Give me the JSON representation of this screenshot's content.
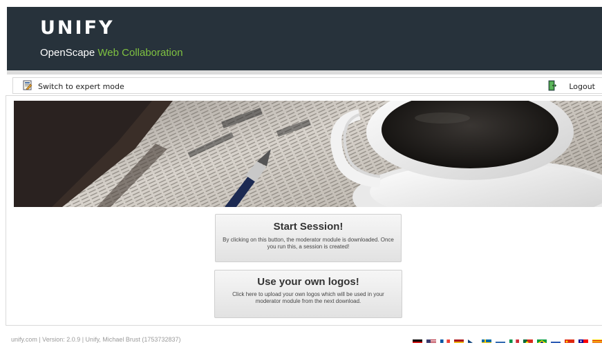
{
  "header": {
    "logo_text": "UNIFY",
    "product_name_part1": "OpenScape",
    "product_name_part2": "Web Collaboration",
    "background": "#27323b",
    "accent": "#7fc241"
  },
  "toolbar": {
    "expert_mode_label": "Switch to expert mode",
    "logout_label": "Logout"
  },
  "main": {
    "start_session": {
      "title": "Start Session!",
      "description": "By clicking on this button, the moderator module is downloaded. Once you run this, a session is created!"
    },
    "own_logos": {
      "title": "Use your own logos!",
      "description": "Click here to upload your own logos which will be used in your moderator module from the next download."
    }
  },
  "footer": {
    "info": "unify.com | Version: 2.0.9 | Unify, Michael Brust (1753732837)"
  },
  "languages": [
    {
      "name": "german-flag-icon",
      "colors": [
        "#000000",
        "#dd0000",
        "#ffce00"
      ],
      "dir": "h"
    },
    {
      "name": "us-flag-icon",
      "colors": [
        "#b22234",
        "#ffffff",
        "#3c3b6e"
      ],
      "dir": "us"
    },
    {
      "name": "french-flag-icon",
      "colors": [
        "#0055a4",
        "#ffffff",
        "#ef4135"
      ],
      "dir": "v"
    },
    {
      "name": "spanish-flag-icon",
      "colors": [
        "#aa151b",
        "#f1bf00",
        "#aa151b"
      ],
      "dir": "h"
    },
    {
      "name": "czech-flag-icon",
      "colors": [
        "#ffffff",
        "#d7141a",
        "#11457e"
      ],
      "dir": "cz"
    },
    {
      "name": "swedish-flag-icon",
      "colors": [
        "#006aa7",
        "#fecc00"
      ],
      "dir": "nordic"
    },
    {
      "name": "slovak-flag-icon",
      "colors": [
        "#ffffff",
        "#0b4ea2",
        "#ee1c25"
      ],
      "dir": "h"
    },
    {
      "name": "italian-flag-icon",
      "colors": [
        "#009246",
        "#ffffff",
        "#ce2b37"
      ],
      "dir": "v"
    },
    {
      "name": "portuguese-flag-icon",
      "colors": [
        "#046a38",
        "#da291c",
        "#da291c"
      ],
      "dir": "pt"
    },
    {
      "name": "brazilian-flag-icon",
      "colors": [
        "#009c3b",
        "#ffdf00",
        "#002776"
      ],
      "dir": "br"
    },
    {
      "name": "russian-flag-icon",
      "colors": [
        "#ffffff",
        "#0039a6",
        "#d52b1e"
      ],
      "dir": "h"
    },
    {
      "name": "chinese-flag-icon",
      "colors": [
        "#de2910",
        "#ffde00"
      ],
      "dir": "cn"
    },
    {
      "name": "taiwan-flag-icon",
      "colors": [
        "#fe0000",
        "#000095",
        "#ffffff"
      ],
      "dir": "tw"
    },
    {
      "name": "catalan-flag-icon",
      "colors": [
        "#fcdd09",
        "#da121a"
      ],
      "dir": "cat"
    }
  ]
}
